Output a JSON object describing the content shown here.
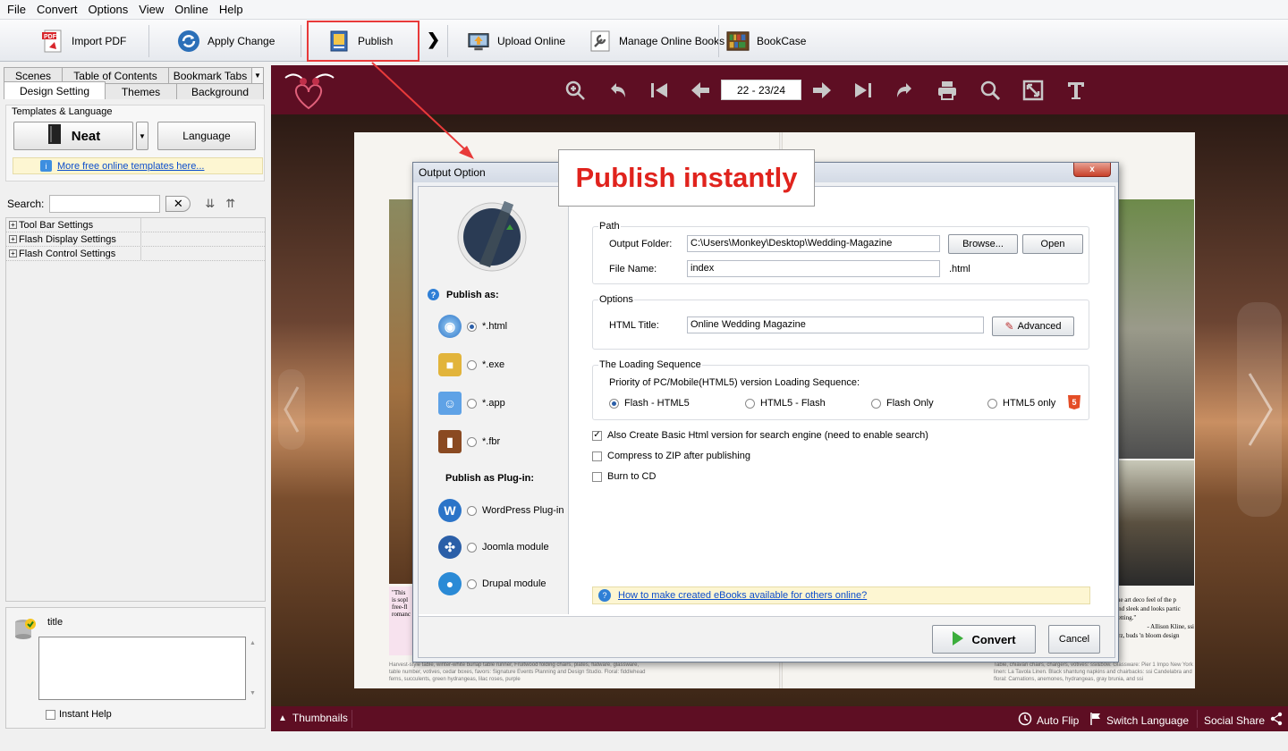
{
  "menu": [
    "File",
    "Convert",
    "Options",
    "View",
    "Online",
    "Help"
  ],
  "toolbar": {
    "import_pdf": "Import PDF",
    "apply_change": "Apply Change",
    "publish": "Publish",
    "more": "❯",
    "upload_online": "Upload Online",
    "manage_online_books": "Manage Online Books",
    "bookcase": "BookCase"
  },
  "left_panel": {
    "tabs_row1": [
      "Scenes",
      "Table of Contents",
      "Bookmark Tabs"
    ],
    "tabs_row2": [
      "Design Setting",
      "Themes",
      "Background"
    ],
    "templates_legend": "Templates & Language",
    "template_name": "Neat",
    "language_button": "Language",
    "more_templates_link": "More free online templates here...",
    "search_label": "Search:",
    "search_value": "",
    "tree": [
      "Tool Bar Settings",
      "Flash Display Settings",
      "Flash Control Settings"
    ],
    "help_title": "title",
    "instant_help_label": "Instant Help"
  },
  "viewer": {
    "page_display": "22 - 23/24",
    "bottom": {
      "thumbnails": "Thumbnails",
      "auto_flip": "Auto Flip",
      "switch_language": "Switch Language",
      "social_share": "Social Share"
    },
    "left_caption_lines": [
      "\"This",
      "is sopl",
      "free-fl",
      "romanc"
    ],
    "right_caption_lines": [
      "the art deco feel of the p",
      "and sleek and looks partic",
      "setting.\"",
      "- Allison Kline, ssi",
      "arz, buds 'n bloom design"
    ],
    "left_credit": "Harvest-style table, winter-white burlap table runner, Fruitwood folding chairs, plates, flatware, glassware, table number, votives, cedar boxes, favors: Signature Events Planning and Design Studio. Floral: fiddlehead ferns, succulents, green hydrangeas, lilac roses, purple",
    "right_credit": "Table, chiavari chairs, chargers, votives: ssi&bow. Glassware: Pier 1 Impo New York linen: La Tavola Linen. Black shantung napkins and chairbacks: ssi Candelabra and floral: Carnations, anemones, hydrangeas, gray brunia, and ssi"
  },
  "callout": "Publish instantly",
  "dialog": {
    "title": "Output Option",
    "close": "x",
    "publish_as_label": "Publish as:",
    "formats": [
      "*.html",
      "*.exe",
      "*.app",
      "*.fbr"
    ],
    "format_selected": "*.html",
    "plugin_label": "Publish as Plug-in:",
    "plugins": [
      "WordPress Plug-in",
      "Joomla module",
      "Drupal module"
    ],
    "path_legend": "Path",
    "output_folder_label": "Output Folder:",
    "output_folder_value": "C:\\Users\\Monkey\\Desktop\\Wedding-Magazine",
    "browse_button": "Browse...",
    "open_button": "Open",
    "file_name_label": "File Name:",
    "file_name_value": "index",
    "file_ext": ".html",
    "options_legend": "Options",
    "html_title_label": "HTML Title:",
    "html_title_value": "Online  Wedding  Magazine",
    "advanced_button": "Advanced",
    "loading_legend": "The Loading Sequence",
    "loading_desc": "Priority of PC/Mobile(HTML5) version Loading Sequence:",
    "loading_options": [
      "Flash - HTML5",
      "HTML5 - Flash",
      "Flash Only",
      "HTML5 only"
    ],
    "loading_selected": "Flash - HTML5",
    "html5_badge": "5",
    "check_basic_html": "Also Create Basic Html version for search engine (need to enable search)",
    "check_basic_html_on": true,
    "check_zip": "Compress to ZIP after publishing",
    "check_cd": "Burn to CD",
    "help_link": "How to make created eBooks available for others online?",
    "convert_button": "Convert",
    "cancel_button": "Cancel"
  },
  "colors": {
    "viewer_bar": "#5e0e23",
    "highlight_red": "#e83a3a",
    "link_blue": "#0b4dcc"
  }
}
